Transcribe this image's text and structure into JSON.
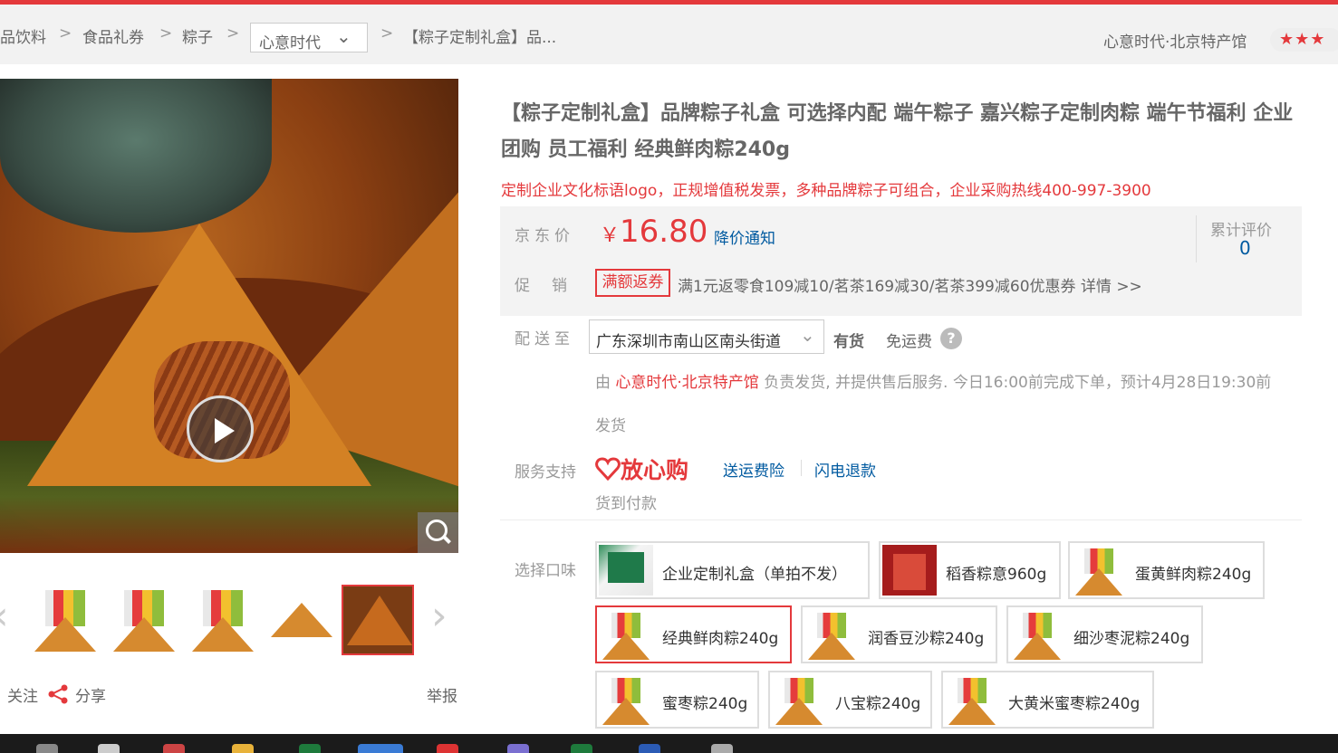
{
  "breadcrumb": {
    "items": [
      "品饮料",
      "食品礼券",
      "粽子"
    ],
    "separator": ">",
    "dropdown": "心意时代",
    "current": "【粽子定制礼盒】品..."
  },
  "shop": {
    "name": "心意时代·北京特产馆",
    "stars": "★★★"
  },
  "gallery": {
    "prev_arrow": "‹",
    "next_arrow": "›",
    "follow": "关注",
    "share": "分享",
    "report": "举报"
  },
  "product": {
    "title": "【粽子定制礼盒】品牌粽子礼盒 可选择内配 端午粽子 嘉兴粽子定制肉粽 端午节福利 企业团购 员工福利 经典鲜肉粽240g",
    "slogan": "定制企业文化标语logo，正规增值税发票，多种品牌粽子可组合，企业采购热线400-997-3900"
  },
  "price": {
    "label": "京东价",
    "currency": "￥",
    "value": "16.80",
    "alert": "降价通知",
    "review_label": "累计评价",
    "review_count": "0"
  },
  "promo": {
    "label": "促销",
    "tag": "满额返券",
    "text": "满1元返零食109减10/茗茶169减30/茗茶399减60优惠券 详情 >>"
  },
  "delivery": {
    "label": "配送至",
    "address": "广东深圳市南山区南头街道",
    "stock": "有货",
    "shipping": "免运费",
    "help": "?",
    "by_prefix": "由 ",
    "shop_link": "心意时代·北京特产馆",
    "by_suffix": " 负责发货, 并提供售后服务. 今日16:00前完成下单，预计4月28日19:30前",
    "line2": "发货"
  },
  "service": {
    "label": "服务支持",
    "brand": "放心购",
    "links": [
      "送运费险",
      "闪电退款"
    ],
    "cod": "货到付款"
  },
  "options": {
    "label": "选择口味",
    "items": [
      "企业定制礼盒（单拍不发）",
      "稻香粽意960g",
      "蛋黄鲜肉粽240g",
      "经典鲜肉粽240g",
      "润香豆沙粽240g",
      "细沙枣泥粽240g",
      "蜜枣粽240g",
      "八宝粽240g",
      "大黄米蜜枣粽240g"
    ],
    "selected": "经典鲜肉粽240g"
  },
  "colors": {
    "accent": "#e4393c",
    "link": "#005aa0"
  }
}
